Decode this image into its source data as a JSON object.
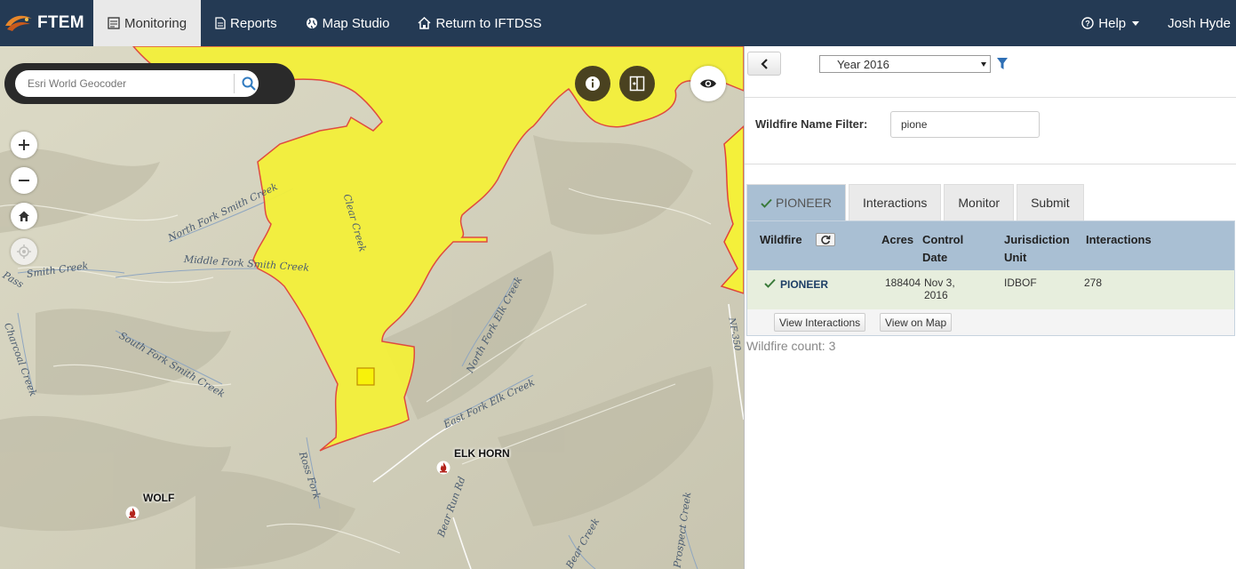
{
  "navbar": {
    "brand": "FTEM",
    "items": [
      {
        "label": "Monitoring",
        "icon": "monitoring-icon",
        "active": true
      },
      {
        "label": "Reports",
        "icon": "document-icon",
        "active": false
      },
      {
        "label": "Map Studio",
        "icon": "globe-icon",
        "active": false
      },
      {
        "label": "Return to IFTDSS",
        "icon": "home-icon",
        "active": false
      }
    ],
    "help": "Help",
    "user": "Josh Hyde"
  },
  "map": {
    "search_placeholder": "Esri World Geocoder",
    "fires": [
      {
        "label": "ELK HORN"
      },
      {
        "label": "WOLF"
      }
    ],
    "places": [
      "North Fork Smith Creek",
      "Middle Fork Smith Creek",
      "Smith Creek",
      "South Fork Smith Creek",
      "Charcoal Creek",
      "Clear Creek",
      "North Fork Elk Creek",
      "East Fork Elk Creek",
      "Ross Fork",
      "Bear Run Rd",
      "Bear Creek",
      "Pass",
      "NF-350",
      "Prospect Creek"
    ],
    "colors": {
      "perimeter_fill": "#f4f03a",
      "perimeter_stroke": "#e0443a",
      "terrain": "#d9d8c4"
    }
  },
  "panel": {
    "year": "Year 2016",
    "filter_label": "Wildfire Name Filter:",
    "filter_value": "pione",
    "tabs": [
      {
        "label": "PIONEER",
        "active": true
      },
      {
        "label": "Interactions",
        "active": false
      },
      {
        "label": "Monitor",
        "active": false
      },
      {
        "label": "Submit",
        "active": false
      }
    ],
    "columns": {
      "wildfire": "Wildfire",
      "acres": "Acres",
      "control_date_1": "Control",
      "control_date_2": "Date",
      "jurisdiction_1": "Jurisdiction",
      "jurisdiction_2": "Unit",
      "interactions": "Interactions"
    },
    "row": {
      "wildfire": "PIONEER",
      "acres": "188404",
      "control_date_1": "Nov 3,",
      "control_date_2": "2016",
      "jurisdiction": "IDBOF",
      "interactions": "278"
    },
    "actions": {
      "view_interactions": "View Interactions",
      "view_on_map": "View on Map"
    },
    "count": "Wildfire count: 3"
  }
}
